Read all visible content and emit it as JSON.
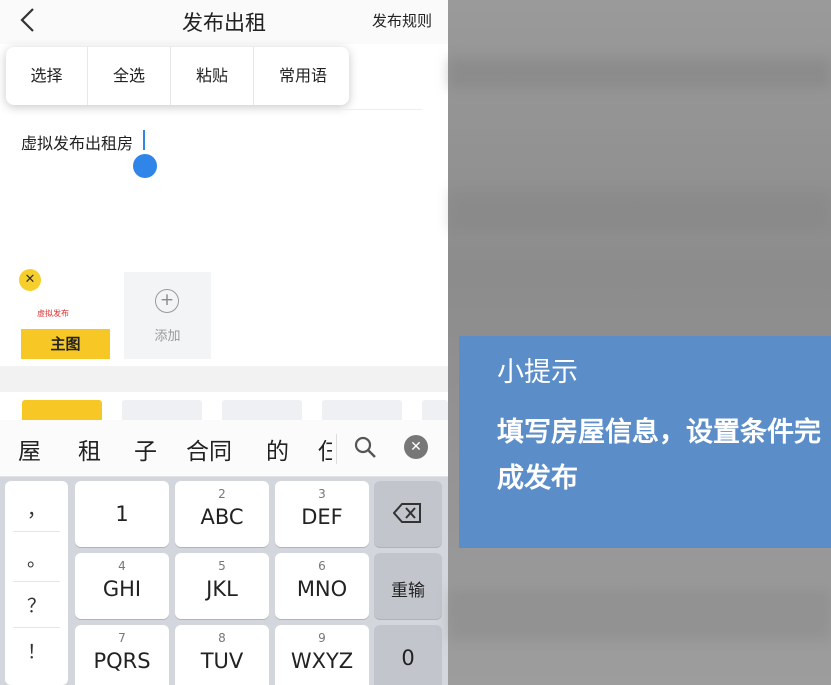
{
  "header": {
    "title": "发布出租",
    "rules_link": "发布规则"
  },
  "context_menu": {
    "items": [
      "选择",
      "全选",
      "粘贴",
      "常用语"
    ]
  },
  "description": {
    "text": "虚拟发布出租房"
  },
  "photos": {
    "thumb_watermark": "虚拟发布",
    "main_badge": "主图",
    "add_label": "添加"
  },
  "ime": {
    "candidates": [
      "屋",
      "租",
      "子",
      "合同",
      "的",
      "仨"
    ]
  },
  "keyboard": {
    "punct": [
      "，",
      "。",
      "？",
      "！"
    ],
    "rows": [
      [
        {
          "num": "",
          "label": "1"
        },
        {
          "num": "2",
          "label": "ABC"
        },
        {
          "num": "3",
          "label": "DEF"
        }
      ],
      [
        {
          "num": "4",
          "label": "GHI"
        },
        {
          "num": "5",
          "label": "JKL"
        },
        {
          "num": "6",
          "label": "MNO"
        }
      ],
      [
        {
          "num": "7",
          "label": "PQRS"
        },
        {
          "num": "8",
          "label": "TUV"
        },
        {
          "num": "9",
          "label": "WXYZ"
        }
      ]
    ],
    "reenter_label": "重输",
    "zero_label": "0"
  },
  "tip": {
    "title": "小提示",
    "body": "填写房屋信息，设置条件完成发布"
  },
  "colors": {
    "accent_yellow": "#f7c825",
    "caret_blue": "#2f86e8",
    "tip_blue": "#5b8dc8"
  }
}
